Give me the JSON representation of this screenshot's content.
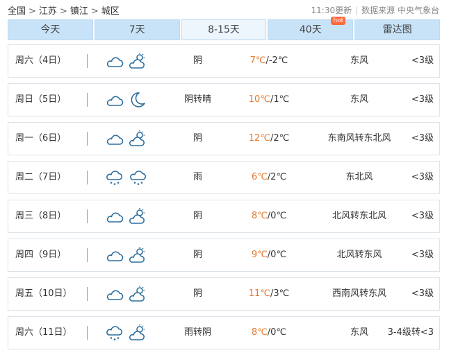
{
  "breadcrumb": {
    "items": [
      "全国",
      "江苏",
      "镇江",
      "城区"
    ]
  },
  "meta": {
    "update_time": "11:30更新",
    "source": "数据来源 中央气象台"
  },
  "tabs": [
    {
      "label": "今天"
    },
    {
      "label": "7天"
    },
    {
      "label": "8-15天",
      "active": true
    },
    {
      "label": "40天",
      "badge": "hot"
    },
    {
      "label": "雷达图"
    }
  ],
  "forecast": [
    {
      "day": "周六（4日）",
      "icons": [
        "cloud-icon",
        "cloudy-day-icon"
      ],
      "condition": "阴",
      "high": "7℃",
      "low": "/-2℃",
      "wind": "东风",
      "level": "<3级"
    },
    {
      "day": "周日（5日）",
      "icons": [
        "cloud-icon",
        "moon-icon"
      ],
      "condition": "阴转晴",
      "high": "10℃",
      "low": "/1℃",
      "wind": "东风",
      "level": "<3级"
    },
    {
      "day": "周一（6日）",
      "icons": [
        "cloud-icon",
        "cloudy-day-icon"
      ],
      "condition": "阴",
      "high": "12℃",
      "low": "/2℃",
      "wind": "东南风转东北风",
      "level": "<3级"
    },
    {
      "day": "周二（7日）",
      "icons": [
        "rain-cloud-icon",
        "rain-cloud-icon"
      ],
      "condition": "雨",
      "high": "6℃",
      "low": "/2℃",
      "wind": "东北风",
      "level": "<3级"
    },
    {
      "day": "周三（8日）",
      "icons": [
        "cloud-icon",
        "cloudy-day-icon"
      ],
      "condition": "阴",
      "high": "8℃",
      "low": "/0℃",
      "wind": "北风转东北风",
      "level": "<3级"
    },
    {
      "day": "周四（9日）",
      "icons": [
        "cloud-icon",
        "cloudy-day-icon"
      ],
      "condition": "阴",
      "high": "9℃",
      "low": "/0℃",
      "wind": "北风转东风",
      "level": "<3级"
    },
    {
      "day": "周五（10日）",
      "icons": [
        "cloud-icon",
        "cloudy-day-icon"
      ],
      "condition": "阴",
      "high": "11℃",
      "low": "/3℃",
      "wind": "西南风转东风",
      "level": "<3级"
    },
    {
      "day": "周六（11日）",
      "icons": [
        "rain-cloud-icon",
        "cloudy-day-icon"
      ],
      "condition": "雨转阴",
      "high": "8℃",
      "low": "/0℃",
      "wind": "东风",
      "level": "3-4级转<3"
    }
  ],
  "colors": {
    "tab_bg": "#c8e3f8",
    "tab_active_bg": "#eef6fd",
    "high_temp": "#e67a2e",
    "icon_stroke": "#2d6f9e",
    "hot_badge": "#ff6a3d"
  }
}
